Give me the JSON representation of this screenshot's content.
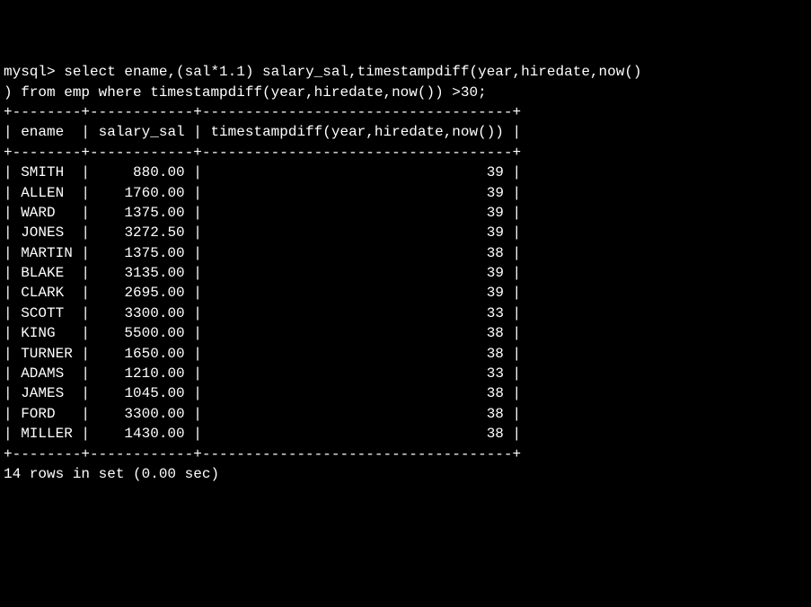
{
  "query": {
    "prompt": "mysql> ",
    "sql_line1": "select ename,(sal*1.1) salary_sal,timestampdiff(year,hiredate,now()",
    "sql_line2": ") from emp where timestampdiff(year,hiredate,now()) >30;"
  },
  "table": {
    "border": "+--------+------------+------------------------------------+",
    "headers": [
      "ename",
      "salary_sal",
      "timestampdiff(year,hiredate,now())"
    ],
    "rows": [
      {
        "ename": "SMITH",
        "salary": "880.00",
        "years": "39"
      },
      {
        "ename": "ALLEN",
        "salary": "1760.00",
        "years": "39"
      },
      {
        "ename": "WARD",
        "salary": "1375.00",
        "years": "39"
      },
      {
        "ename": "JONES",
        "salary": "3272.50",
        "years": "39"
      },
      {
        "ename": "MARTIN",
        "salary": "1375.00",
        "years": "38"
      },
      {
        "ename": "BLAKE",
        "salary": "3135.00",
        "years": "39"
      },
      {
        "ename": "CLARK",
        "salary": "2695.00",
        "years": "39"
      },
      {
        "ename": "SCOTT",
        "salary": "3300.00",
        "years": "33"
      },
      {
        "ename": "KING",
        "salary": "5500.00",
        "years": "38"
      },
      {
        "ename": "TURNER",
        "salary": "1650.00",
        "years": "38"
      },
      {
        "ename": "ADAMS",
        "salary": "1210.00",
        "years": "33"
      },
      {
        "ename": "JAMES",
        "salary": "1045.00",
        "years": "38"
      },
      {
        "ename": "FORD",
        "salary": "3300.00",
        "years": "38"
      },
      {
        "ename": "MILLER",
        "salary": "1430.00",
        "years": "38"
      }
    ]
  },
  "footer": {
    "status": "14 rows in set (0.00 sec)"
  }
}
